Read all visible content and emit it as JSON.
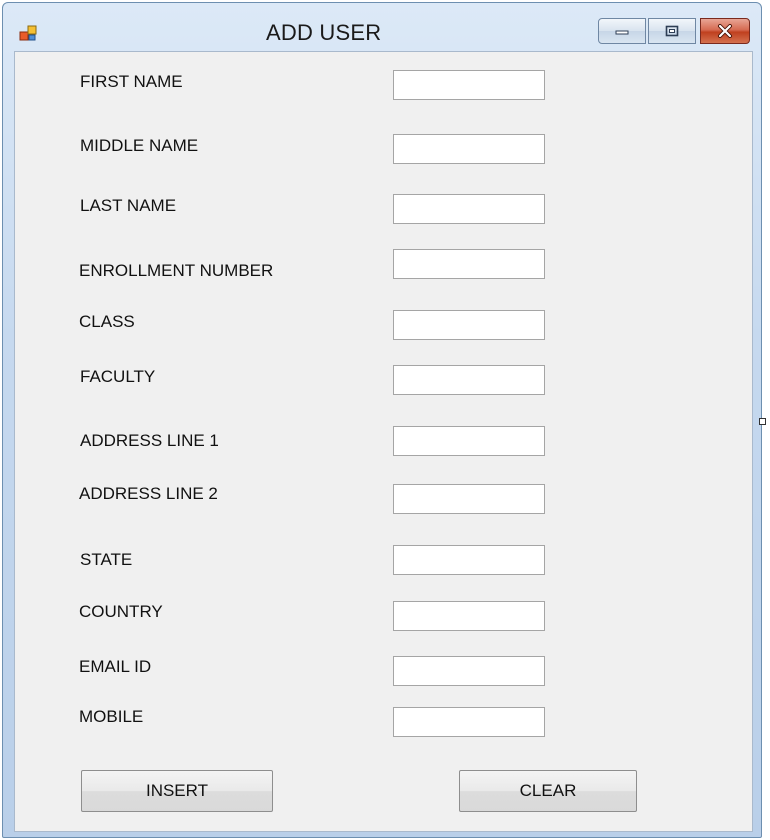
{
  "window": {
    "title": "ADD USER",
    "controls": [
      "minimize-icon",
      "maximize-icon",
      "close-icon"
    ]
  },
  "form": {
    "fields": [
      {
        "label": "FIRST NAME",
        "value": ""
      },
      {
        "label": "MIDDLE NAME",
        "value": ""
      },
      {
        "label": "LAST NAME",
        "value": ""
      },
      {
        "label": "ENROLLMENT NUMBER",
        "value": ""
      },
      {
        "label": "CLASS",
        "value": ""
      },
      {
        "label": "FACULTY",
        "value": ""
      },
      {
        "label": "ADDRESS LINE 1",
        "value": ""
      },
      {
        "label": "ADDRESS LINE 2",
        "value": ""
      },
      {
        "label": "STATE",
        "value": ""
      },
      {
        "label": "COUNTRY",
        "value": ""
      },
      {
        "label": "EMAIL ID",
        "value": ""
      },
      {
        "label": "MOBILE",
        "value": ""
      }
    ]
  },
  "buttons": {
    "insert": "INSERT",
    "clear": "CLEAR"
  },
  "colors": {
    "titlebar": "#c6d9ef",
    "client_bg": "#f0f0f0",
    "close_button": "#c0401f"
  }
}
